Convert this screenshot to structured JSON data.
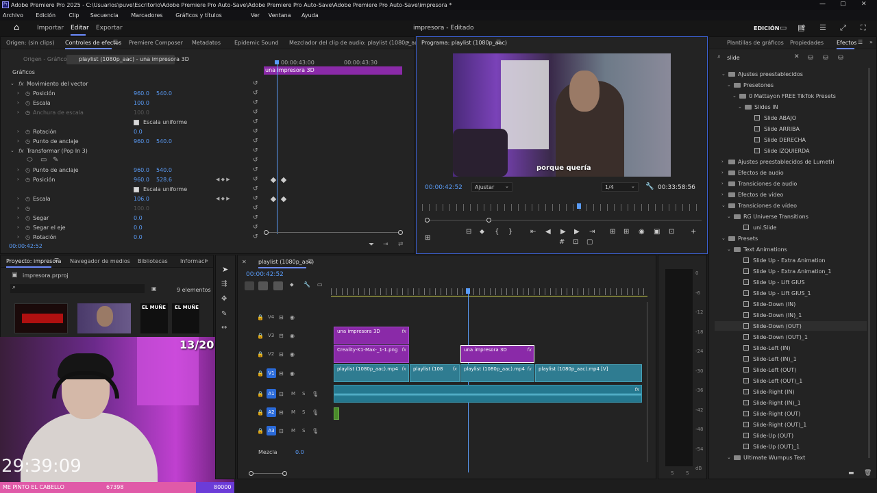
{
  "window": {
    "title": "Adobe Premiere Pro 2025 - C:\\Usuarios\\puve\\Escritorio\\Adobe Premiere Pro Auto-Save\\Adobe Premiere Pro Auto-Save\\Adobe Premiere Pro Auto-Save\\impresora *"
  },
  "menu": [
    "Archivo",
    "Edición",
    "Clip",
    "Secuencia",
    "Marcadores",
    "Gráficos y títulos",
    "Ver",
    "Ventana",
    "Ayuda"
  ],
  "toolbar": {
    "import": "Importar",
    "edit": "Editar",
    "export": "Exportar",
    "project_title": "impresora - Editado",
    "workspace": "EDICIÓN"
  },
  "effect_controls": {
    "tabs": [
      "Origen: (sin clips)",
      "Controles de efectos",
      "Premiere Composer",
      "Metadatos",
      "Epidemic Sound",
      "Mezclador del clip de audio: playlist (1080p_aac)"
    ],
    "source_label": "Origen - Gráfico",
    "clip_label": "playlist (1080p_aac) - una impresora 3D",
    "time_a": "00:00:43:00",
    "time_b": "00:00:43:30",
    "clip_bar": "una impresora 3D",
    "section": "Gráficos",
    "rows": [
      {
        "label": "Movimiento del vector",
        "v1": "",
        "v2": ""
      },
      {
        "label": "Posición",
        "v1": "960.0",
        "v2": "540.0"
      },
      {
        "label": "Escala",
        "v1": "100.0",
        "v2": ""
      },
      {
        "label": "Anchura de escala",
        "v1": "100.0",
        "v2": ""
      },
      {
        "label": "Escala uniforme",
        "v1": "",
        "v2": ""
      },
      {
        "label": "Rotación",
        "v1": "0.0",
        "v2": ""
      },
      {
        "label": "Punto de anclaje",
        "v1": "960.0",
        "v2": "540.0"
      },
      {
        "label": "Transformar (Pop In 3)",
        "v1": "",
        "v2": ""
      },
      {
        "label": "",
        "v1": "",
        "v2": ""
      },
      {
        "label": "Punto de anclaje",
        "v1": "960.0",
        "v2": "540.0"
      },
      {
        "label": "Posición",
        "v1": "960.0",
        "v2": "528.6"
      },
      {
        "label": "Escala uniforme",
        "v1": "",
        "v2": ""
      },
      {
        "label": "Escala",
        "v1": "106.0",
        "v2": ""
      },
      {
        "label": "",
        "v1": "100.0",
        "v2": ""
      },
      {
        "label": "Segar",
        "v1": "0.0",
        "v2": ""
      },
      {
        "label": "Segar el eje",
        "v1": "0.0",
        "v2": ""
      },
      {
        "label": "Rotación",
        "v1": "0.0",
        "v2": ""
      }
    ],
    "timecode": "00:00:42:52"
  },
  "program": {
    "title": "Programa: playlist (1080p_aac)",
    "caption": "porque quería",
    "timecode": "00:00:42:52",
    "fit": "Ajustar",
    "quality": "1/4",
    "duration": "00:33:58:56"
  },
  "effects": {
    "tabs": [
      "Plantillas de gráficos",
      "Propiedades",
      "Efectos"
    ],
    "search": "slide",
    "tree": [
      {
        "label": "Ajustes preestablecidos",
        "level": 0,
        "type": "folder",
        "open": true
      },
      {
        "label": "Presetones",
        "level": 1,
        "type": "folder",
        "open": true
      },
      {
        "label": "0 Mattayon FREE TikTok Presets",
        "level": 2,
        "type": "folder",
        "open": true
      },
      {
        "label": "Slides IN",
        "level": 3,
        "type": "folder",
        "open": true
      },
      {
        "label": "Slide ABAJO",
        "level": 4,
        "type": "preset"
      },
      {
        "label": "Slide ARRIBA",
        "level": 4,
        "type": "preset"
      },
      {
        "label": "Slide DERECHA",
        "level": 4,
        "type": "preset"
      },
      {
        "label": "Slide IZQUIERDA",
        "level": 4,
        "type": "preset"
      },
      {
        "label": "Ajustes preestablecidos de Lumetri",
        "level": 0,
        "type": "folder",
        "open": false
      },
      {
        "label": "Efectos de audio",
        "level": 0,
        "type": "folder",
        "open": false
      },
      {
        "label": "Transiciones de audio",
        "level": 0,
        "type": "folder",
        "open": false
      },
      {
        "label": "Efectos de vídeo",
        "level": 0,
        "type": "folder",
        "open": false
      },
      {
        "label": "Transiciones de vídeo",
        "level": 0,
        "type": "folder",
        "open": true
      },
      {
        "label": "RG Universe Transitions",
        "level": 1,
        "type": "folder",
        "open": true
      },
      {
        "label": "uni.Slide",
        "level": 2,
        "type": "preset"
      },
      {
        "label": "Presets",
        "level": 0,
        "type": "folder",
        "open": true
      },
      {
        "label": "Text Animations",
        "level": 1,
        "type": "folder",
        "open": true
      },
      {
        "label": "Slide Up - Extra Animation",
        "level": 2,
        "type": "preset"
      },
      {
        "label": "Slide Up - Extra Animation_1",
        "level": 2,
        "type": "preset"
      },
      {
        "label": "Slide Up - Lift GIUS",
        "level": 2,
        "type": "preset"
      },
      {
        "label": "Slide Up - Lift GIUS_1",
        "level": 2,
        "type": "preset"
      },
      {
        "label": "Slide-Down (IN)",
        "level": 2,
        "type": "preset"
      },
      {
        "label": "Slide-Down (IN)_1",
        "level": 2,
        "type": "preset"
      },
      {
        "label": "Slide-Down (OUT)",
        "level": 2,
        "type": "preset",
        "selected": true
      },
      {
        "label": "Slide-Down (OUT)_1",
        "level": 2,
        "type": "preset"
      },
      {
        "label": "Slide-Left (IN)",
        "level": 2,
        "type": "preset"
      },
      {
        "label": "Slide-Left (IN)_1",
        "level": 2,
        "type": "preset"
      },
      {
        "label": "Slide-Left (OUT)",
        "level": 2,
        "type": "preset"
      },
      {
        "label": "Slide-Left (OUT)_1",
        "level": 2,
        "type": "preset"
      },
      {
        "label": "Slide-Right (IN)",
        "level": 2,
        "type": "preset"
      },
      {
        "label": "Slide-Right (IN)_1",
        "level": 2,
        "type": "preset"
      },
      {
        "label": "Slide-Right (OUT)",
        "level": 2,
        "type": "preset"
      },
      {
        "label": "Slide-Right (OUT)_1",
        "level": 2,
        "type": "preset"
      },
      {
        "label": "Slide-Up (OUT)",
        "level": 2,
        "type": "preset"
      },
      {
        "label": "Slide-Up (OUT)_1",
        "level": 2,
        "type": "preset"
      },
      {
        "label": "Ultimate Wumpus Text",
        "level": 1,
        "type": "folder",
        "open": true
      }
    ]
  },
  "project": {
    "tabs": [
      "Proyecto: impresora",
      "Navegador de medios",
      "Bibliotecas",
      "Informaci"
    ],
    "file": "impresora.prproj",
    "count": "9 elementos",
    "thumb_texts": [
      "EL MUÑE",
      "EL MUÑE"
    ]
  },
  "timeline": {
    "tab": "playlist (1080p_aac)",
    "timecode": "00:00:42:52",
    "tracks": [
      "V4",
      "V3",
      "V2",
      "V1",
      "A1",
      "A2",
      "A3"
    ],
    "mix_label": "Mezcla",
    "mix_value": "0.0",
    "clips": {
      "v3": "una impresora 3D",
      "v2a": "Creality-K1-Max-_1-1.png",
      "v2b": "una impresora 3D",
      "v1a": "playlist (1080p_aac).mp4",
      "v1b": "playlist (108",
      "v1c": "playlist (1080p_aac).mp4",
      "v1d": "playlist (1080p_aac).mp4 [V]"
    },
    "meter_labels": [
      "0",
      "-6",
      "-12",
      "-18",
      "-24",
      "-30",
      "-36",
      "-42",
      "-48",
      "-54",
      "dB"
    ]
  },
  "webcam": {
    "counter": "13/20",
    "clock": "29:39:09"
  },
  "stream_bar": {
    "left": "ME PINTO EL CABELLO",
    "mid": "67398",
    "right": "80000"
  },
  "fx_letter": "fx"
}
